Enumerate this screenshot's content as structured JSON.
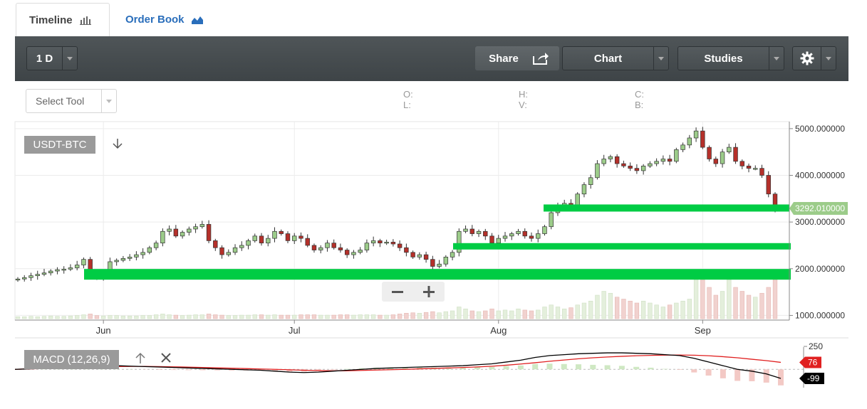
{
  "tabs": [
    {
      "label": "Timeline",
      "icon": "bar-chart-icon"
    },
    {
      "label": "Order Book",
      "icon": "area-chart-icon"
    }
  ],
  "toolbar": {
    "interval": "1 D",
    "share_label": "Share",
    "chart_label": "Chart",
    "studies_label": "Studies",
    "settings_icon": "gear-icon"
  },
  "subbar": {
    "select_tool": "Select Tool",
    "o_label": "O:",
    "l_label": "L:",
    "h_label": "H:",
    "v_label": "V:",
    "c_label": "C:",
    "b_label": "B:"
  },
  "colors": {
    "up": "#9ccc8a",
    "down": "#b5302a",
    "support": "#00cc44",
    "macd_line": "#000000",
    "signal_line": "#e02020",
    "price_tag": "#9ccc8a"
  },
  "chart_data": [
    {
      "type": "candlestick",
      "symbol": "USDT-BTC",
      "x_tick_labels": [
        "Jun",
        "Jul",
        "Aug",
        "Sep"
      ],
      "y_tick_labels": [
        "5000.000000",
        "4000.000000",
        "3000.000000",
        "2000.000000",
        "1000.000000"
      ],
      "ylim": [
        900,
        5150
      ],
      "grid": true,
      "last_price_label": "3292.010000",
      "last_price": 3292,
      "support_levels": [
        3300,
        2480,
        1880
      ],
      "closes": [
        1780,
        1810,
        1850,
        1880,
        1910,
        1950,
        1980,
        1990,
        2020,
        2080,
        2200,
        1900,
        1800,
        1850,
        2150,
        2180,
        2220,
        2250,
        2300,
        2350,
        2450,
        2550,
        2800,
        2850,
        2700,
        2780,
        2850,
        2900,
        2950,
        2600,
        2450,
        2300,
        2350,
        2450,
        2500,
        2600,
        2700,
        2550,
        2650,
        2800,
        2750,
        2600,
        2700,
        2650,
        2500,
        2400,
        2450,
        2550,
        2450,
        2400,
        2300,
        2350,
        2400,
        2550,
        2600,
        2550,
        2570,
        2530,
        2450,
        2350,
        2250,
        2300,
        2200,
        2050,
        2100,
        2250,
        2350,
        2800,
        2850,
        2750,
        2800,
        2700,
        2550,
        2650,
        2700,
        2750,
        2800,
        2700,
        2650,
        2750,
        2900,
        3200,
        3350,
        3400,
        3350,
        3600,
        3800,
        3950,
        4250,
        4350,
        4400,
        4250,
        4200,
        4150,
        4100,
        4200,
        4250,
        4300,
        4350,
        4300,
        4550,
        4650,
        4800,
        4950,
        4600,
        4350,
        4250,
        4500,
        4600,
        4300,
        4200,
        4150,
        4150,
        4000,
        3600,
        3292
      ],
      "volume_scale_label": "",
      "volume_relative": [
        0.05,
        0.05,
        0.06,
        0.05,
        0.06,
        0.07,
        0.06,
        0.06,
        0.07,
        0.08,
        0.1,
        0.12,
        0.08,
        0.07,
        0.08,
        0.08,
        0.07,
        0.07,
        0.07,
        0.08,
        0.08,
        0.1,
        0.12,
        0.1,
        0.09,
        0.08,
        0.09,
        0.1,
        0.1,
        0.12,
        0.1,
        0.09,
        0.08,
        0.08,
        0.09,
        0.09,
        0.1,
        0.1,
        0.09,
        0.1,
        0.09,
        0.09,
        0.09,
        0.1,
        0.1,
        0.1,
        0.09,
        0.09,
        0.09,
        0.1,
        0.1,
        0.09,
        0.1,
        0.1,
        0.1,
        0.09,
        0.09,
        0.1,
        0.12,
        0.14,
        0.15,
        0.14,
        0.16,
        0.18,
        0.15,
        0.18,
        0.2,
        0.3,
        0.25,
        0.2,
        0.18,
        0.2,
        0.25,
        0.2,
        0.22,
        0.2,
        0.25,
        0.22,
        0.2,
        0.22,
        0.3,
        0.35,
        0.3,
        0.25,
        0.28,
        0.35,
        0.4,
        0.45,
        0.6,
        0.7,
        0.65,
        0.55,
        0.5,
        0.45,
        0.4,
        0.45,
        0.4,
        0.35,
        0.3,
        0.35,
        0.4,
        0.45,
        0.5,
        1.0,
        1.0,
        0.8,
        0.6,
        0.7,
        1.0,
        0.8,
        0.7,
        0.6,
        0.55,
        0.65,
        0.8,
        1.0
      ]
    },
    {
      "type": "line",
      "indicator": "MACD",
      "label": "MACD (12,26,9)",
      "y_tick_labels": [
        "250"
      ],
      "signal_value_label": "76",
      "macd_value_label": "-99",
      "macd": [
        0,
        5,
        10,
        15,
        20,
        25,
        35,
        40,
        35,
        30,
        25,
        20,
        15,
        10,
        5,
        0,
        -5,
        -10,
        -20,
        -30,
        -35,
        -30,
        -20,
        -10,
        0,
        10,
        15,
        20,
        25,
        30,
        35,
        40,
        50,
        60,
        80,
        100,
        130,
        150,
        160,
        170,
        175,
        180,
        180,
        175,
        170,
        160,
        150,
        120,
        80,
        40,
        0,
        -20,
        -50,
        -99
      ],
      "signal": [
        0,
        5,
        8,
        12,
        16,
        20,
        25,
        30,
        32,
        32,
        30,
        27,
        24,
        20,
        16,
        12,
        8,
        4,
        0,
        -5,
        -10,
        -14,
        -16,
        -15,
        -12,
        -8,
        -4,
        0,
        5,
        10,
        15,
        20,
        26,
        34,
        45,
        58,
        72,
        88,
        102,
        115,
        126,
        135,
        142,
        148,
        152,
        155,
        156,
        154,
        148,
        138,
        126,
        110,
        95,
        76
      ]
    }
  ]
}
